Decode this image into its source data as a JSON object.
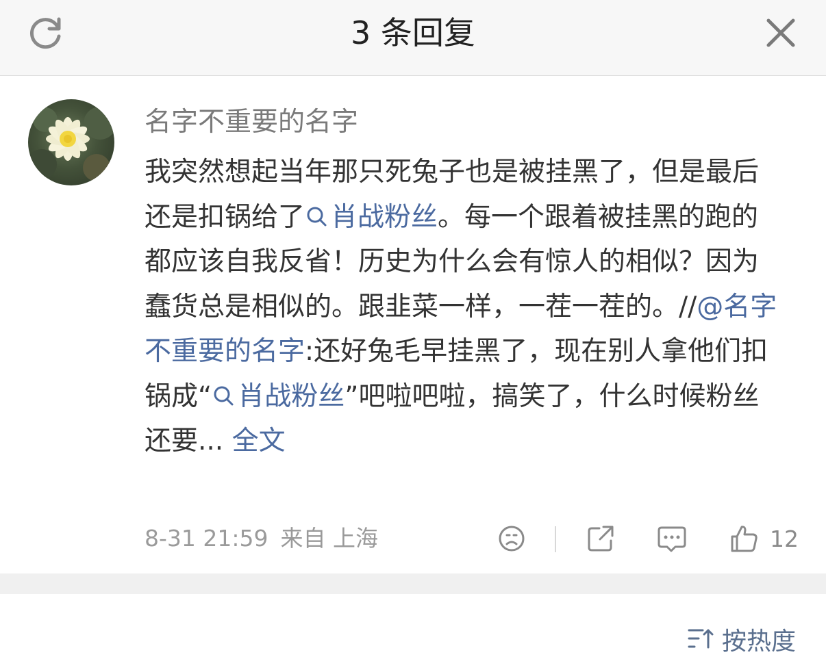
{
  "header": {
    "title": "3 条回复",
    "refresh_icon": "refresh-icon",
    "close_icon": "close-icon"
  },
  "comment": {
    "username": "名字不重要的名字",
    "text": {
      "p1": "我突然想起当年那只死兔子也是被挂黑了，但是最后还是扣锅给了",
      "topic1": "肖战粉丝",
      "p2": "。每一个跟着被挂黑的跑的都应该自我反省！历史为什么会有惊人的相似？因为蠢货总是相似的。跟韭菜一样，一茬一茬的。//",
      "mention": "@名字不重要的名字",
      "p3": ":还好兔毛早挂黑了，现在别人拿他们扣锅成“",
      "topic2a": "肖",
      "topic2b": "战粉丝",
      "p4": "”吧啦吧啦，搞笑了，什么时候粉丝还要... ",
      "full_text": "全文"
    },
    "time": "8-31 21:59",
    "from": "来自 上海",
    "actions": {
      "dislike_icon": "frown-face-icon",
      "share_icon": "share-icon",
      "comment_icon": "comment-icon",
      "like_icon": "thumbs-up-icon",
      "like_count": "12"
    }
  },
  "footer": {
    "sort_icon": "sort-icon",
    "sort_label": "按热度"
  },
  "colors": {
    "link": "#4b6aa0",
    "text": "#333333",
    "meta": "#9a9a9a",
    "header_bg": "#f7f7f7"
  }
}
